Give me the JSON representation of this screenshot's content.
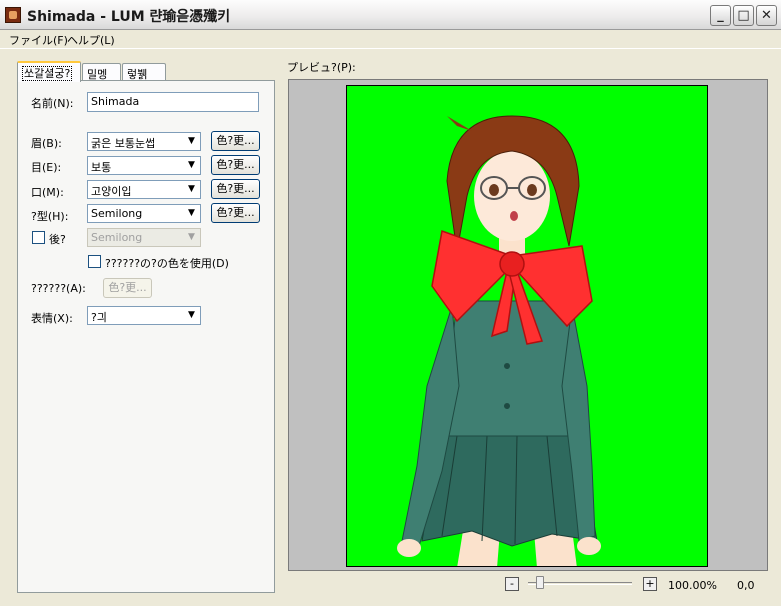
{
  "window": {
    "title": "Shimada - LUM 랸瑜읃憑殲키",
    "controls": {
      "minimize": "_",
      "maximize": "□",
      "close": "✕"
    }
  },
  "menu": [
    {
      "label": "ファイル(F)"
    },
    {
      "label": "ヘルプ(L)"
    }
  ],
  "tabs": [
    {
      "label": "쏘갈셜궁?",
      "active": true
    },
    {
      "label": "밀멩"
    },
    {
      "label": "렇뷁"
    }
  ],
  "form": {
    "name": {
      "label": "名前(N):",
      "value": "Shimada"
    },
    "brow": {
      "label": "眉(B):",
      "value": "굵은 보통눈썹",
      "color_button": "色?更..."
    },
    "eye": {
      "label": "目(E):",
      "value": "보통",
      "color_button": "色?更..."
    },
    "mouth": {
      "label": "口(M):",
      "value": "고양이입",
      "color_button": "色?更..."
    },
    "hair": {
      "label": "?型(H):",
      "value": "Semilong",
      "color_button": "色?更..."
    },
    "back": {
      "label": "後?",
      "value": "Semilong",
      "checked": false
    },
    "use_color_check": {
      "label": "??????の?の色を使用(D)",
      "checked": false
    },
    "special": {
      "label": "??????(A):",
      "color_button": "色?更..."
    },
    "expression": {
      "label": "表情(X):",
      "value": "?긔"
    }
  },
  "preview": {
    "label": "プレビュ?(P):",
    "background_color": "#00ff00",
    "zoom_minus": "-",
    "zoom_plus": "+",
    "zoom": "100.00%",
    "coords": "0,0"
  }
}
